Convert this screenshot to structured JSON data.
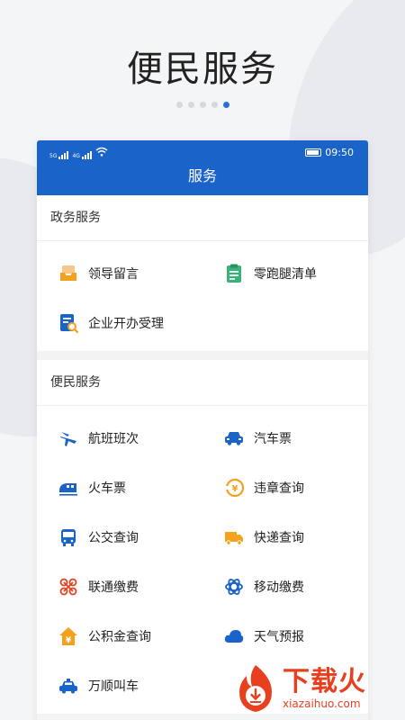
{
  "hero": {
    "title": "便民服务",
    "dots_total": 5,
    "dots_active": 5
  },
  "status": {
    "net1": "5G",
    "net2": "4G",
    "time": "09:50"
  },
  "app": {
    "title": "服务"
  },
  "gov_section": {
    "title": "政务服务",
    "items": [
      {
        "label": "领导留言",
        "icon": "inbox-icon"
      },
      {
        "label": "零跑腿清单",
        "icon": "checklist-icon"
      },
      {
        "label": "企业开办受理",
        "icon": "document-search-icon"
      }
    ]
  },
  "civic_section": {
    "title": "便民服务",
    "items": [
      {
        "label": "航班班次",
        "icon": "plane-icon"
      },
      {
        "label": "汽车票",
        "icon": "car-icon"
      },
      {
        "label": "火车票",
        "icon": "train-icon"
      },
      {
        "label": "违章查询",
        "icon": "violation-icon"
      },
      {
        "label": "公交查询",
        "icon": "bus-icon"
      },
      {
        "label": "快递查询",
        "icon": "truck-icon"
      },
      {
        "label": "联通缴费",
        "icon": "unicom-icon"
      },
      {
        "label": "移动缴费",
        "icon": "mobile-icon"
      },
      {
        "label": "公积金查询",
        "icon": "fund-icon"
      },
      {
        "label": "天气预报",
        "icon": "cloud-icon"
      },
      {
        "label": "万顺叫车",
        "icon": "taxi-icon"
      }
    ]
  },
  "watermark": {
    "cn": "下载火",
    "en": "xiazaihuo.com"
  },
  "colors": {
    "primary": "#1a63c9",
    "orange": "#f4a11d",
    "green": "#3bb078",
    "red": "#e8401f"
  }
}
